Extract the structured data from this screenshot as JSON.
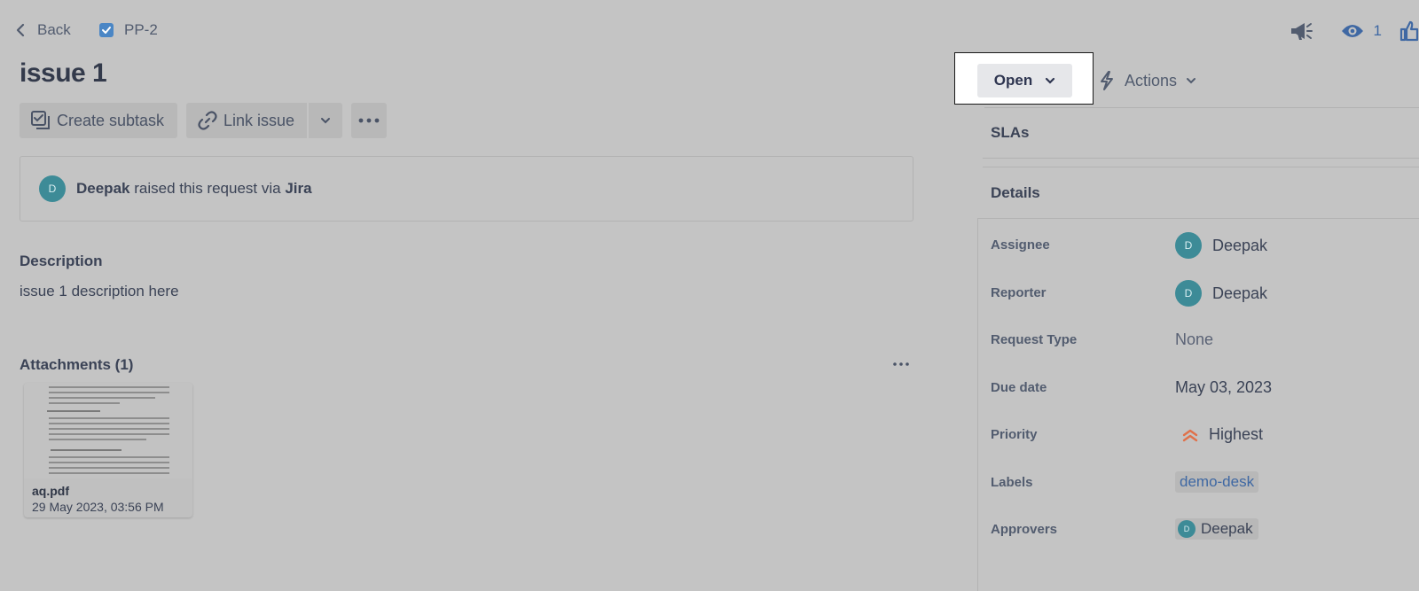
{
  "nav": {
    "back_label": "Back",
    "issue_key": "PP-2"
  },
  "top_actions": {
    "watch_count": "1"
  },
  "issue": {
    "title": "issue 1"
  },
  "toolbar": {
    "create_subtask": "Create subtask",
    "link_issue": "Link issue"
  },
  "request": {
    "avatar_initial": "D",
    "user": "Deepak",
    "text": "raised this request via",
    "channel": "Jira"
  },
  "description": {
    "heading": "Description",
    "text": "issue 1 description here"
  },
  "attachments": {
    "heading": "Attachments (1)",
    "items": [
      {
        "name": "aq.pdf",
        "date": "29 May 2023, 03:56 PM"
      }
    ]
  },
  "status": {
    "label": "Open"
  },
  "actions": {
    "label": "Actions"
  },
  "sections": {
    "slas": "SLAs",
    "details": "Details"
  },
  "details": {
    "assignee_label": "Assignee",
    "assignee": "Deepak",
    "reporter_label": "Reporter",
    "reporter": "Deepak",
    "request_type_label": "Request Type",
    "request_type": "None",
    "due_date_label": "Due date",
    "due_date": "May 03, 2023",
    "priority_label": "Priority",
    "priority": "Highest",
    "labels_label": "Labels",
    "labels": [
      "demo-desk"
    ],
    "approvers_label": "Approvers",
    "approver": "Deepak",
    "avatar_initial": "D"
  },
  "colors": {
    "avatar": "#3d8b97",
    "priority_highest": "#e0714a",
    "label_link": "#3f68a3",
    "checkbox": "#4a86c5"
  }
}
